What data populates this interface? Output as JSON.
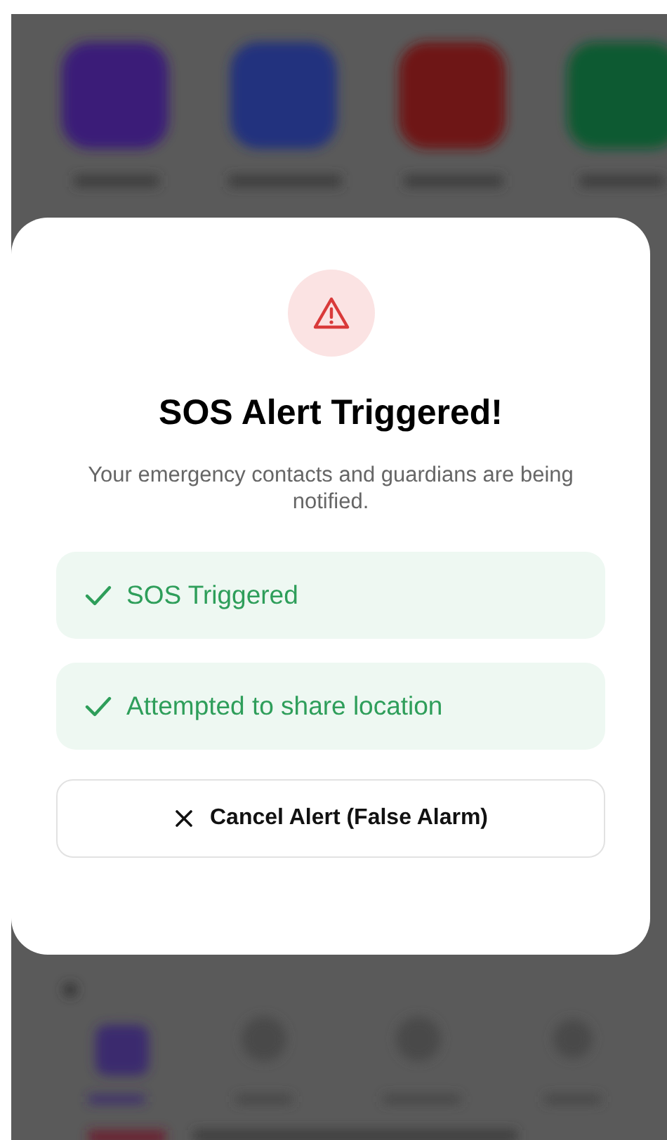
{
  "alert": {
    "title": "SOS Alert Triggered!",
    "message": "Your emergency contacts and guardians are being notified.",
    "steps": [
      {
        "label": "SOS Triggered",
        "done": true
      },
      {
        "label": "Attempted to share location",
        "done": true
      }
    ],
    "cancel_button": "Cancel Alert (False Alarm)"
  }
}
